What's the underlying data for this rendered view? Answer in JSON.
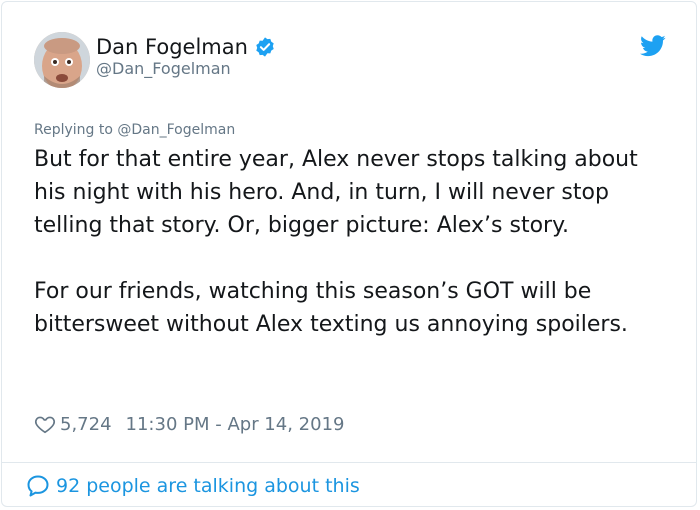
{
  "author": {
    "display_name": "Dan Fogelman",
    "handle": "@Dan_Fogelman",
    "verified_icon": "verified-badge-icon",
    "avatar_icon": "avatar-photo"
  },
  "brand": {
    "icon": "twitter-bird-icon",
    "accent_color": "#1da1f2"
  },
  "tweet": {
    "replying_to": "Replying to @Dan_Fogelman",
    "paragraphs": [
      "But for that entire year, Alex never stops talking about his night with his hero. And, in turn, I will never stop telling that story.  Or, bigger picture: Alex’s story.",
      "For our friends, watching this season’s GOT will be bittersweet without Alex texting us annoying spoilers."
    ],
    "like_count": "5,724",
    "timestamp": "11:30 PM - Apr 14, 2019"
  },
  "footer": {
    "talking_label": "92 people are talking about this",
    "link_color": "#1b95e0"
  }
}
